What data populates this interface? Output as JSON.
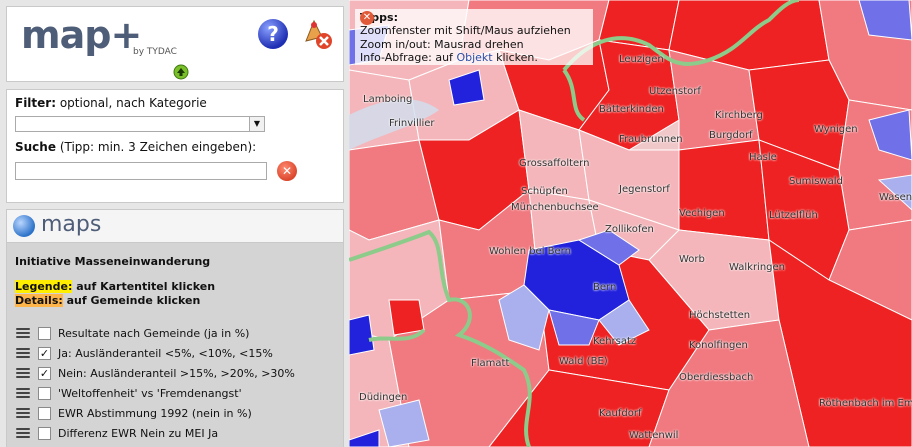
{
  "logo": {
    "text": "map+",
    "by": "by TYDAC"
  },
  "filter": {
    "label": "Filter:",
    "hint": "optional, nach Kategorie",
    "selected": ""
  },
  "search": {
    "label": "Suche",
    "hint": "(Tipp: min. 3 Zeichen eingeben):",
    "value": ""
  },
  "maps": {
    "title": "maps",
    "layer_group_title": "Initiative Masseneinwanderung",
    "legend_prefix": "Legende:",
    "legend_text": "auf Kartentitel klicken",
    "details_prefix": "Details:",
    "details_text": "auf Gemeinde klicken",
    "layers": [
      {
        "label": "Resultate nach Gemeinde (ja in %)",
        "checked": false
      },
      {
        "label": "Ja: Ausländeranteil <5%, <10%, <15%",
        "checked": true
      },
      {
        "label": "Nein: Ausländeranteil >15%, >20%, >30%",
        "checked": true
      },
      {
        "label": "'Weltoffenheit' vs 'Fremdenangst'",
        "checked": false
      },
      {
        "label": "EWR Abstimmung 1992 (nein in %)",
        "checked": false
      },
      {
        "label": "Differenz EWR Nein zu MEI Ja",
        "checked": false
      }
    ]
  },
  "tips": {
    "title": "Tipps:",
    "line1": "Zoomfenster mit Shift/Maus aufziehen",
    "line2": "Zoom in/out: Mausrad drehen",
    "line3_prefix": "Info-Abfrage: auf",
    "line3_link": "Objekt",
    "line3_suffix": "klicken."
  },
  "map_labels": [
    "Lamboing",
    "Frinvillier",
    "Leuzigen",
    "Utzenstorf",
    "Wynigen",
    "Fraubrunnen",
    "Grossaffoltern",
    "Schüpfen",
    "Münchenbuchsee",
    "Zollikofen",
    "Wohlen bei Bern",
    "Bern",
    "Kehrsatz",
    "Wald (BE)",
    "Oberdiessbach",
    "Höchstetten",
    "Walkringen",
    "Sumiswald",
    "Wasen",
    "Lützelflüh",
    "Röthenbach im Emmental",
    "Kaufdorf",
    "Wattenwil",
    "Flamatt",
    "Düdingen",
    "Konolfingen",
    "Worb",
    "Hasle",
    "Kirchberg",
    "Burgdorf",
    "Bätterkinden",
    "Jegenstorf",
    "Vechigen"
  ],
  "colors": {
    "strong_yes": "#ee2222",
    "yes": "#f07a80",
    "light_yes": "#f4b6ba",
    "light_no": "#aab0ee",
    "no": "#7070e8",
    "strong_no": "#2222dd",
    "border": "#8ccb8a"
  }
}
